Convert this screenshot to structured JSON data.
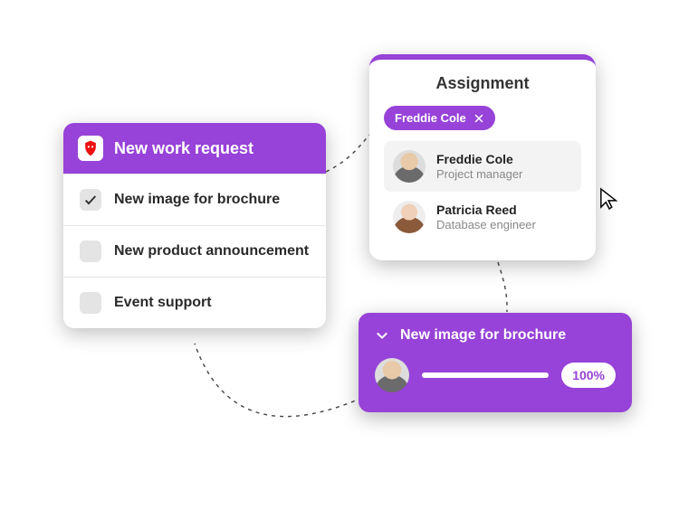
{
  "colors": {
    "accent": "#9742d8"
  },
  "request": {
    "title": "New work request",
    "app_icon": "lion-shield-icon",
    "items": [
      {
        "label": "New image for brochure",
        "checked": true
      },
      {
        "label": "New product announcement",
        "checked": false
      },
      {
        "label": "Event support",
        "checked": false
      }
    ]
  },
  "assignment": {
    "title": "Assignment",
    "chip": {
      "label": "Freddie Cole"
    },
    "people": [
      {
        "name": "Freddie Cole",
        "role": "Project manager",
        "highlight": true
      },
      {
        "name": "Patricia Reed",
        "role": "Database engineer",
        "highlight": false
      }
    ]
  },
  "progress": {
    "title": "New image for brochure",
    "percent_label": "100%"
  }
}
